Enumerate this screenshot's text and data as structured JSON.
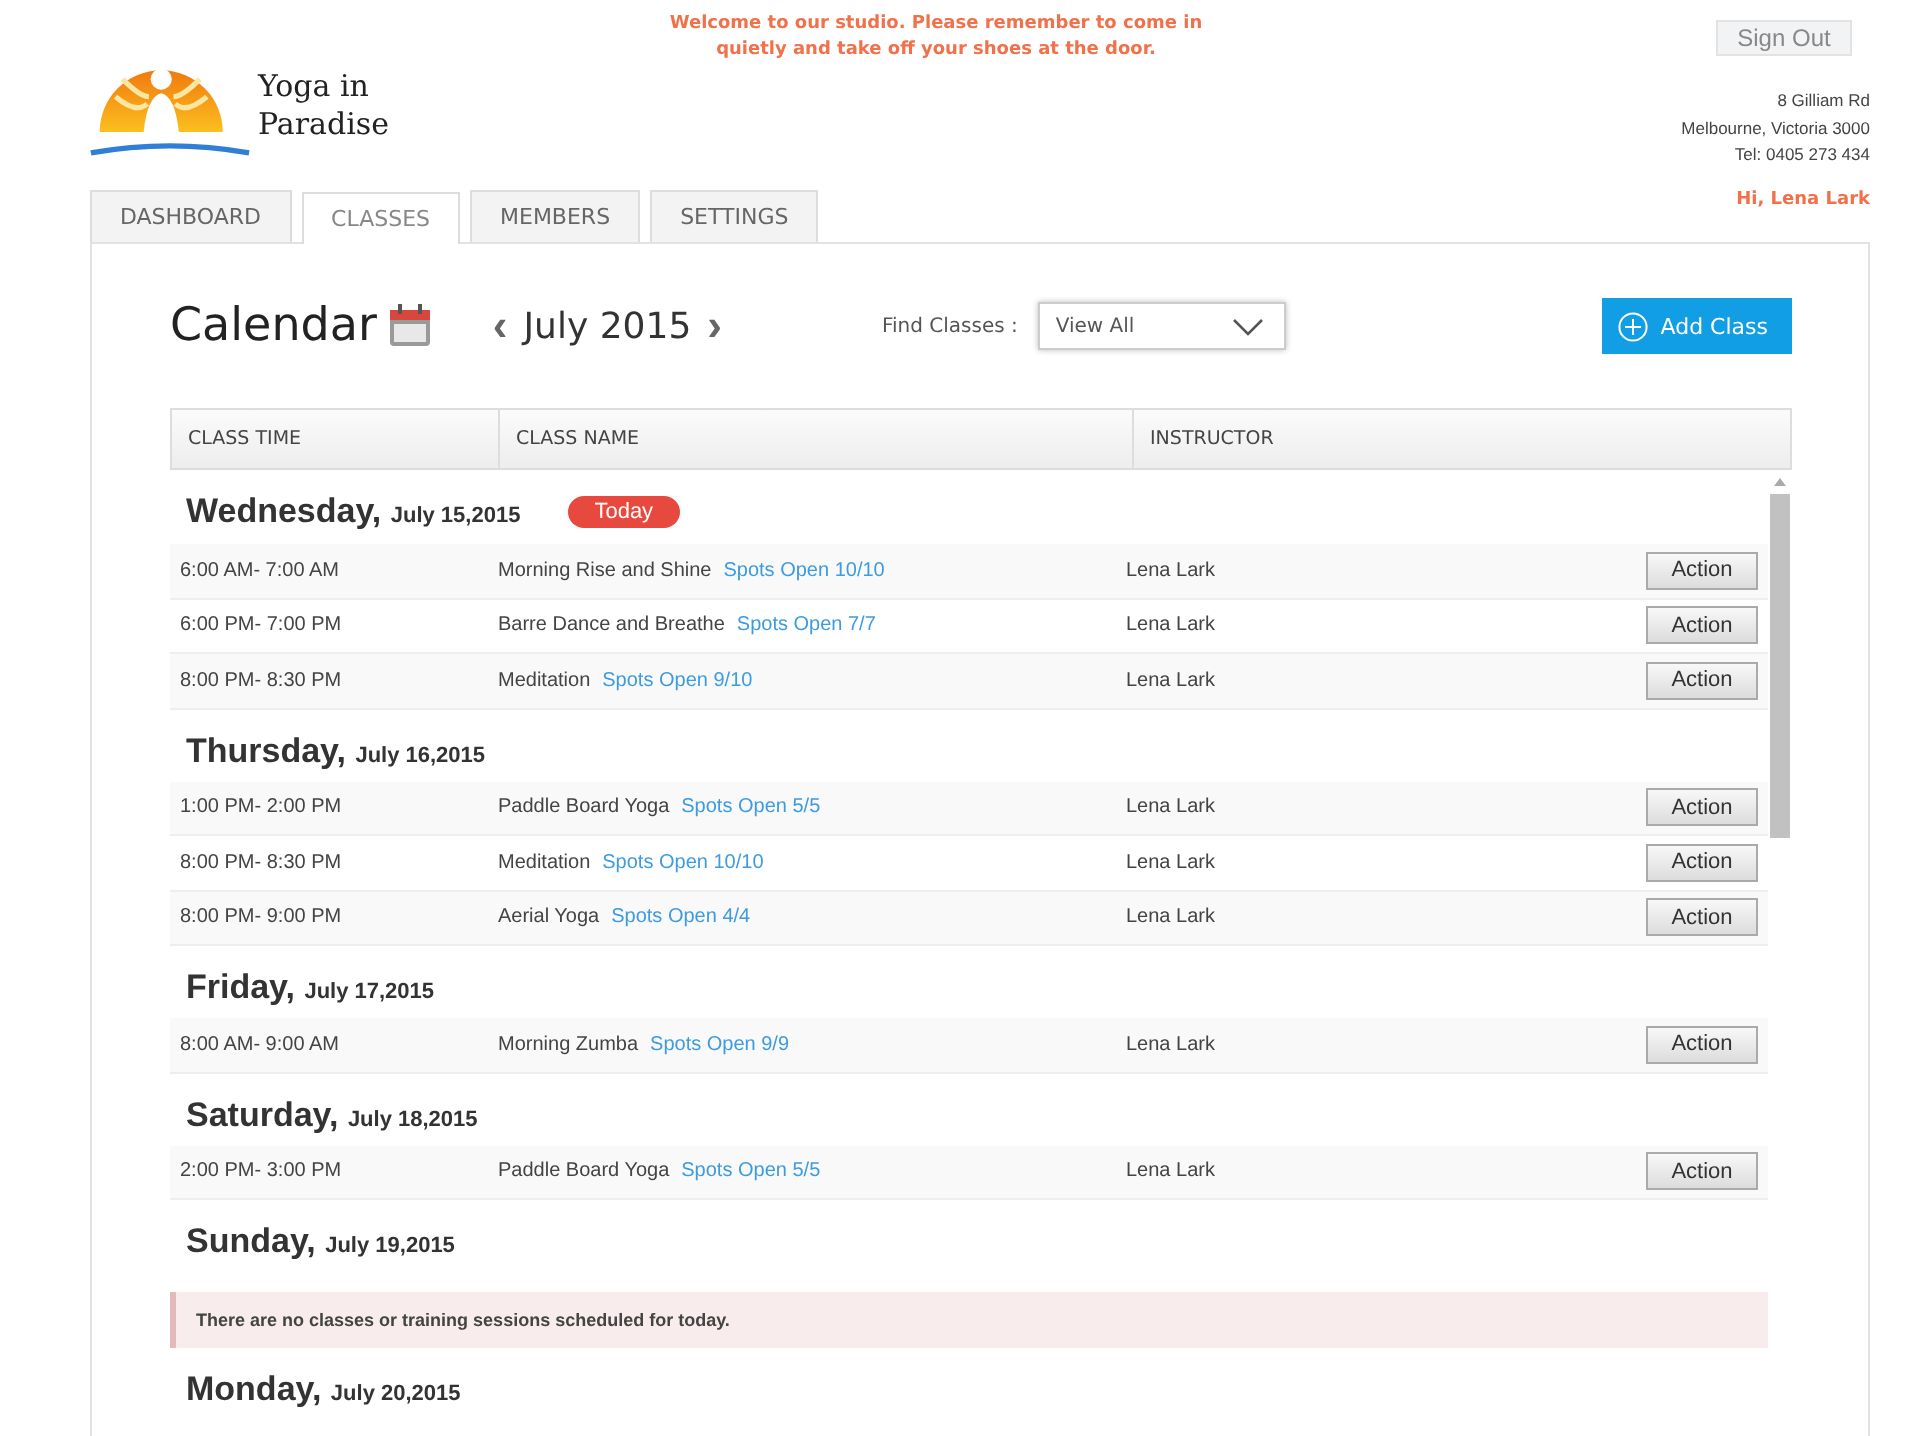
{
  "header": {
    "logo_text": [
      "Yoga in",
      "Paradise"
    ],
    "notice": "Welcome to our studio. Please remember to come in quietly and take off your shoes at the door.",
    "sign_out": "Sign Out",
    "address": [
      "8 Gilliam Rd",
      "Melbourne, Victoria 3000",
      "Tel:  0405 273 434"
    ],
    "greeting": "Hi, Lena Lark"
  },
  "tabs": [
    {
      "label": "DASHBOARD",
      "selected": false
    },
    {
      "label": "CLASSES",
      "selected": true
    },
    {
      "label": "MEMBERS",
      "selected": false
    },
    {
      "label": "SETTINGS",
      "selected": false
    }
  ],
  "toolbar": {
    "title": "Calendar",
    "prev": "‹",
    "month": "July 2015",
    "next": "›",
    "find_label": "Find Classes :",
    "find_value": "View All",
    "add_button": "Add Class"
  },
  "table": {
    "columns": [
      "CLASS TIME",
      "CLASS NAME",
      "INSTRUCTOR"
    ],
    "days": [
      {
        "day": "Wednesday,",
        "date": "July 15,2015",
        "today": true,
        "badge": "Today",
        "rows": [
          {
            "time": "6:00 AM- 7:00 AM",
            "name": "Morning Rise and Shine",
            "spots": "Spots Open 10/10",
            "instructor": "Lena Lark",
            "action": "Action"
          },
          {
            "time": "6:00 PM- 7:00 PM",
            "name": "Barre Dance and Breathe",
            "spots": "Spots Open 7/7",
            "instructor": "Lena Lark",
            "action": "Action"
          },
          {
            "time": "8:00 PM- 8:30 PM",
            "name": "Meditation",
            "spots": "Spots Open 9/10",
            "instructor": "Lena Lark",
            "action": "Action"
          }
        ]
      },
      {
        "day": "Thursday,",
        "date": "July 16,2015",
        "today": false,
        "rows": [
          {
            "time": "1:00 PM- 2:00 PM",
            "name": "Paddle Board Yoga",
            "spots": "Spots Open 5/5",
            "instructor": "Lena Lark",
            "action": "Action"
          },
          {
            "time": "8:00 PM- 8:30 PM",
            "name": "Meditation",
            "spots": "Spots Open 10/10",
            "instructor": "Lena Lark",
            "action": "Action"
          },
          {
            "time": "8:00 PM- 9:00 PM",
            "name": "Aerial Yoga",
            "spots": "Spots Open 4/4",
            "instructor": "Lena Lark",
            "action": "Action"
          }
        ]
      },
      {
        "day": "Friday,",
        "date": "July 17,2015",
        "today": false,
        "rows": [
          {
            "time": "8:00 AM- 9:00 AM",
            "name": "Morning Zumba",
            "spots": "Spots Open 9/9",
            "instructor": "Lena Lark",
            "action": "Action"
          }
        ]
      },
      {
        "day": "Saturday,",
        "date": "July 18,2015",
        "today": false,
        "rows": [
          {
            "time": "2:00 PM- 3:00 PM",
            "name": "Paddle Board Yoga",
            "spots": "Spots Open 5/5",
            "instructor": "Lena Lark",
            "action": "Action"
          }
        ]
      },
      {
        "day": "Sunday,",
        "date": "July 19,2015",
        "today": false,
        "message": "There are no classes or training sessions scheduled for today."
      },
      {
        "day": "Monday,",
        "date": "July 20,2015",
        "today": false
      }
    ]
  }
}
